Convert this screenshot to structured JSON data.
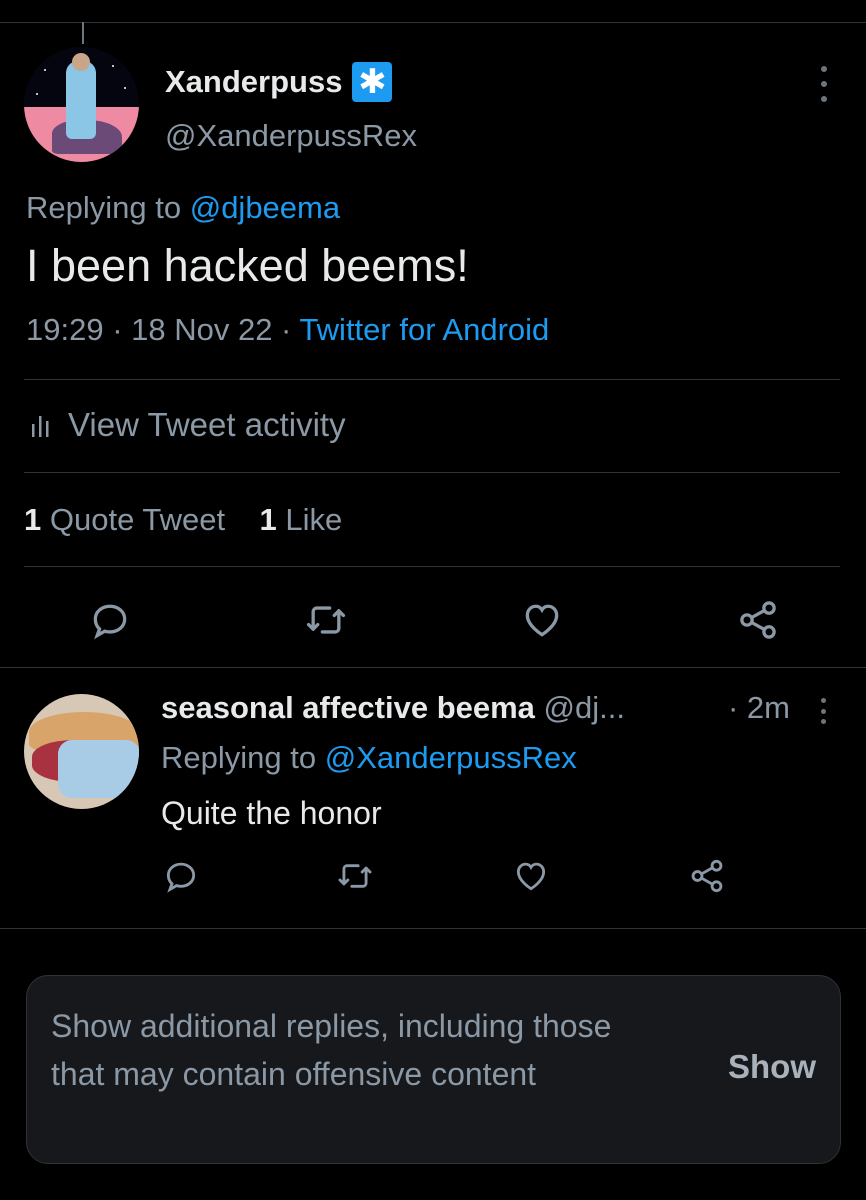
{
  "main_tweet": {
    "display_name": "Xanderpuss",
    "badge_symbol": "✱",
    "handle": "@XanderpussRex",
    "replying_prefix": "Replying to ",
    "replying_to": "@djbeema",
    "text": "I been hacked beems!",
    "time": "19:29 · 18 Nov 22 · ",
    "source": "Twitter for Android",
    "activity_label": "View Tweet activity",
    "quote_count": "1",
    "quote_label": " Quote Tweet",
    "like_count": "1",
    "like_label": " Like"
  },
  "reply": {
    "display_name": "seasonal affective beema",
    "handle": " @dj...",
    "time": "· 2m",
    "replying_prefix": "Replying to ",
    "replying_to": "@XanderpussRex",
    "text": "Quite the honor"
  },
  "notice": {
    "text": "Show additional replies, including those that may contain offensive content",
    "button": "Show"
  },
  "colors": {
    "background": "#000000",
    "accent": "#1d9bf0",
    "secondary_text": "#8b98a5",
    "divider": "#2f3336"
  },
  "icons": [
    "reply-icon",
    "retweet-icon",
    "like-icon",
    "share-icon",
    "more-icon",
    "analytics-icon"
  ]
}
